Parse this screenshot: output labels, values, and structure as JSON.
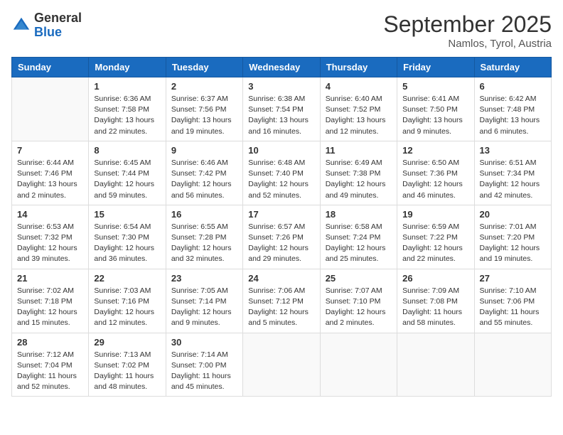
{
  "header": {
    "logo_general": "General",
    "logo_blue": "Blue",
    "month_title": "September 2025",
    "location": "Namlos, Tyrol, Austria"
  },
  "days_of_week": [
    "Sunday",
    "Monday",
    "Tuesday",
    "Wednesday",
    "Thursday",
    "Friday",
    "Saturday"
  ],
  "weeks": [
    [
      {
        "day": "",
        "info": ""
      },
      {
        "day": "1",
        "info": "Sunrise: 6:36 AM\nSunset: 7:58 PM\nDaylight: 13 hours and 22 minutes."
      },
      {
        "day": "2",
        "info": "Sunrise: 6:37 AM\nSunset: 7:56 PM\nDaylight: 13 hours and 19 minutes."
      },
      {
        "day": "3",
        "info": "Sunrise: 6:38 AM\nSunset: 7:54 PM\nDaylight: 13 hours and 16 minutes."
      },
      {
        "day": "4",
        "info": "Sunrise: 6:40 AM\nSunset: 7:52 PM\nDaylight: 13 hours and 12 minutes."
      },
      {
        "day": "5",
        "info": "Sunrise: 6:41 AM\nSunset: 7:50 PM\nDaylight: 13 hours and 9 minutes."
      },
      {
        "day": "6",
        "info": "Sunrise: 6:42 AM\nSunset: 7:48 PM\nDaylight: 13 hours and 6 minutes."
      }
    ],
    [
      {
        "day": "7",
        "info": "Sunrise: 6:44 AM\nSunset: 7:46 PM\nDaylight: 13 hours and 2 minutes."
      },
      {
        "day": "8",
        "info": "Sunrise: 6:45 AM\nSunset: 7:44 PM\nDaylight: 12 hours and 59 minutes."
      },
      {
        "day": "9",
        "info": "Sunrise: 6:46 AM\nSunset: 7:42 PM\nDaylight: 12 hours and 56 minutes."
      },
      {
        "day": "10",
        "info": "Sunrise: 6:48 AM\nSunset: 7:40 PM\nDaylight: 12 hours and 52 minutes."
      },
      {
        "day": "11",
        "info": "Sunrise: 6:49 AM\nSunset: 7:38 PM\nDaylight: 12 hours and 49 minutes."
      },
      {
        "day": "12",
        "info": "Sunrise: 6:50 AM\nSunset: 7:36 PM\nDaylight: 12 hours and 46 minutes."
      },
      {
        "day": "13",
        "info": "Sunrise: 6:51 AM\nSunset: 7:34 PM\nDaylight: 12 hours and 42 minutes."
      }
    ],
    [
      {
        "day": "14",
        "info": "Sunrise: 6:53 AM\nSunset: 7:32 PM\nDaylight: 12 hours and 39 minutes."
      },
      {
        "day": "15",
        "info": "Sunrise: 6:54 AM\nSunset: 7:30 PM\nDaylight: 12 hours and 36 minutes."
      },
      {
        "day": "16",
        "info": "Sunrise: 6:55 AM\nSunset: 7:28 PM\nDaylight: 12 hours and 32 minutes."
      },
      {
        "day": "17",
        "info": "Sunrise: 6:57 AM\nSunset: 7:26 PM\nDaylight: 12 hours and 29 minutes."
      },
      {
        "day": "18",
        "info": "Sunrise: 6:58 AM\nSunset: 7:24 PM\nDaylight: 12 hours and 25 minutes."
      },
      {
        "day": "19",
        "info": "Sunrise: 6:59 AM\nSunset: 7:22 PM\nDaylight: 12 hours and 22 minutes."
      },
      {
        "day": "20",
        "info": "Sunrise: 7:01 AM\nSunset: 7:20 PM\nDaylight: 12 hours and 19 minutes."
      }
    ],
    [
      {
        "day": "21",
        "info": "Sunrise: 7:02 AM\nSunset: 7:18 PM\nDaylight: 12 hours and 15 minutes."
      },
      {
        "day": "22",
        "info": "Sunrise: 7:03 AM\nSunset: 7:16 PM\nDaylight: 12 hours and 12 minutes."
      },
      {
        "day": "23",
        "info": "Sunrise: 7:05 AM\nSunset: 7:14 PM\nDaylight: 12 hours and 9 minutes."
      },
      {
        "day": "24",
        "info": "Sunrise: 7:06 AM\nSunset: 7:12 PM\nDaylight: 12 hours and 5 minutes."
      },
      {
        "day": "25",
        "info": "Sunrise: 7:07 AM\nSunset: 7:10 PM\nDaylight: 12 hours and 2 minutes."
      },
      {
        "day": "26",
        "info": "Sunrise: 7:09 AM\nSunset: 7:08 PM\nDaylight: 11 hours and 58 minutes."
      },
      {
        "day": "27",
        "info": "Sunrise: 7:10 AM\nSunset: 7:06 PM\nDaylight: 11 hours and 55 minutes."
      }
    ],
    [
      {
        "day": "28",
        "info": "Sunrise: 7:12 AM\nSunset: 7:04 PM\nDaylight: 11 hours and 52 minutes."
      },
      {
        "day": "29",
        "info": "Sunrise: 7:13 AM\nSunset: 7:02 PM\nDaylight: 11 hours and 48 minutes."
      },
      {
        "day": "30",
        "info": "Sunrise: 7:14 AM\nSunset: 7:00 PM\nDaylight: 11 hours and 45 minutes."
      },
      {
        "day": "",
        "info": ""
      },
      {
        "day": "",
        "info": ""
      },
      {
        "day": "",
        "info": ""
      },
      {
        "day": "",
        "info": ""
      }
    ]
  ]
}
